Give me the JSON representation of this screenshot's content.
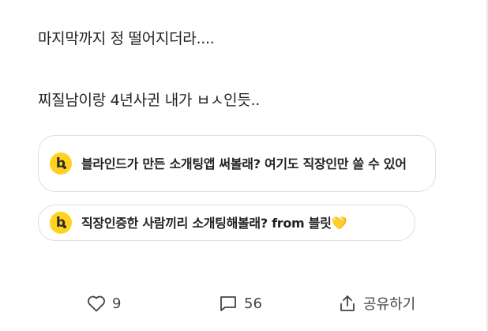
{
  "post": {
    "line1": "마지막까지 정 떨어지더라....",
    "line2": "찌질남이랑 4년사귄 내가 ㅂㅅ인듯.."
  },
  "promos": [
    {
      "badge": "b",
      "text": "블라인드가 만든 소개팅앱 써볼래? 여기도 직장인만 쓸 수 있어"
    },
    {
      "badge": "b",
      "text": "직장인증한 사람끼리 소개팅해볼래? from 블릿💛"
    }
  ],
  "actions": {
    "likes": "9",
    "comments": "56",
    "share_label": "공유하기"
  },
  "icons": {
    "like": "heart-icon",
    "comment": "comment-icon",
    "share": "share-icon"
  },
  "colors": {
    "badge": "#ffd21f",
    "text": "#222222",
    "border": "#dedede"
  }
}
